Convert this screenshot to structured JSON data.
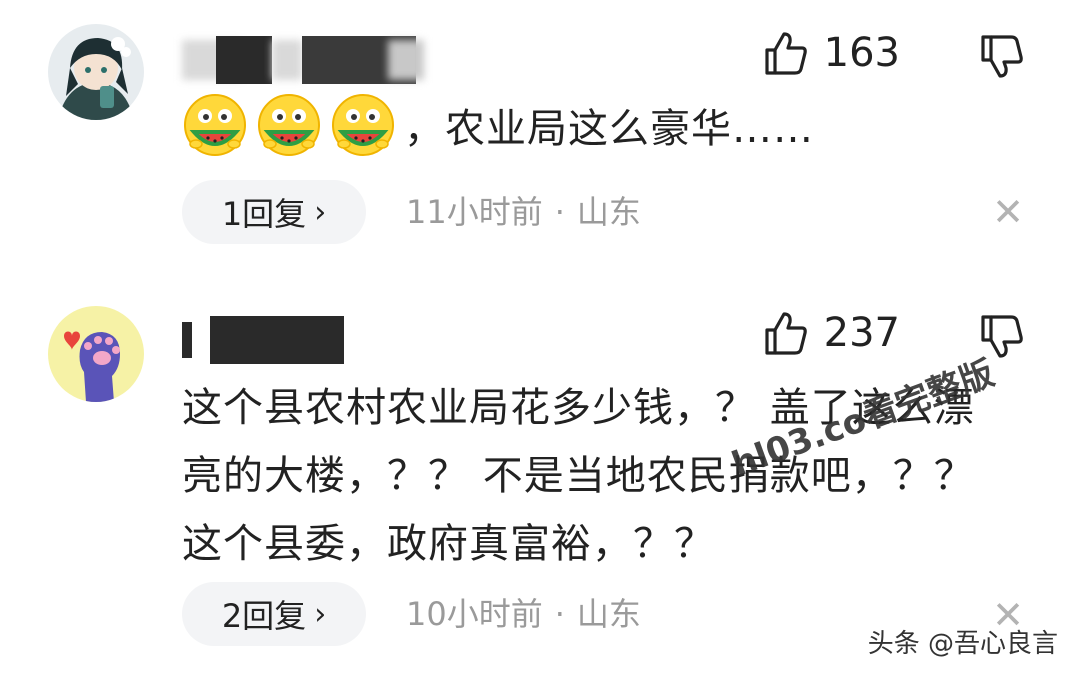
{
  "comments": [
    {
      "likes": "163",
      "text": "，农业局这么豪华……",
      "emoji_count": 3,
      "replies": "1回复",
      "time": "11小时前",
      "dot": "·",
      "location": "山东"
    },
    {
      "likes": "237",
      "text": "这个县农村农业局花多少钱，？ 盖了这么漂亮的大楼，？？ 不是当地农民捐款吧，？？ 这个县委，政府真富裕，？？",
      "replies": "2回复",
      "time": "10小时前",
      "dot": "·",
      "location": "山东"
    }
  ],
  "icons": {
    "like": "thumbs-up-icon",
    "dislike": "thumbs-down-icon",
    "close": "close-icon",
    "chevron": "chevron-right-icon",
    "emoji": "watermelon-emoji-icon"
  },
  "reply_chevron": "›",
  "close_glyph": "✕",
  "watermark": "hl03.co看完整版",
  "signature": "头条 @吾心良言",
  "colors": {
    "text": "#222222",
    "meta": "#9a9a9a",
    "pill": "#f3f4f6",
    "close": "#b3b3b3"
  }
}
